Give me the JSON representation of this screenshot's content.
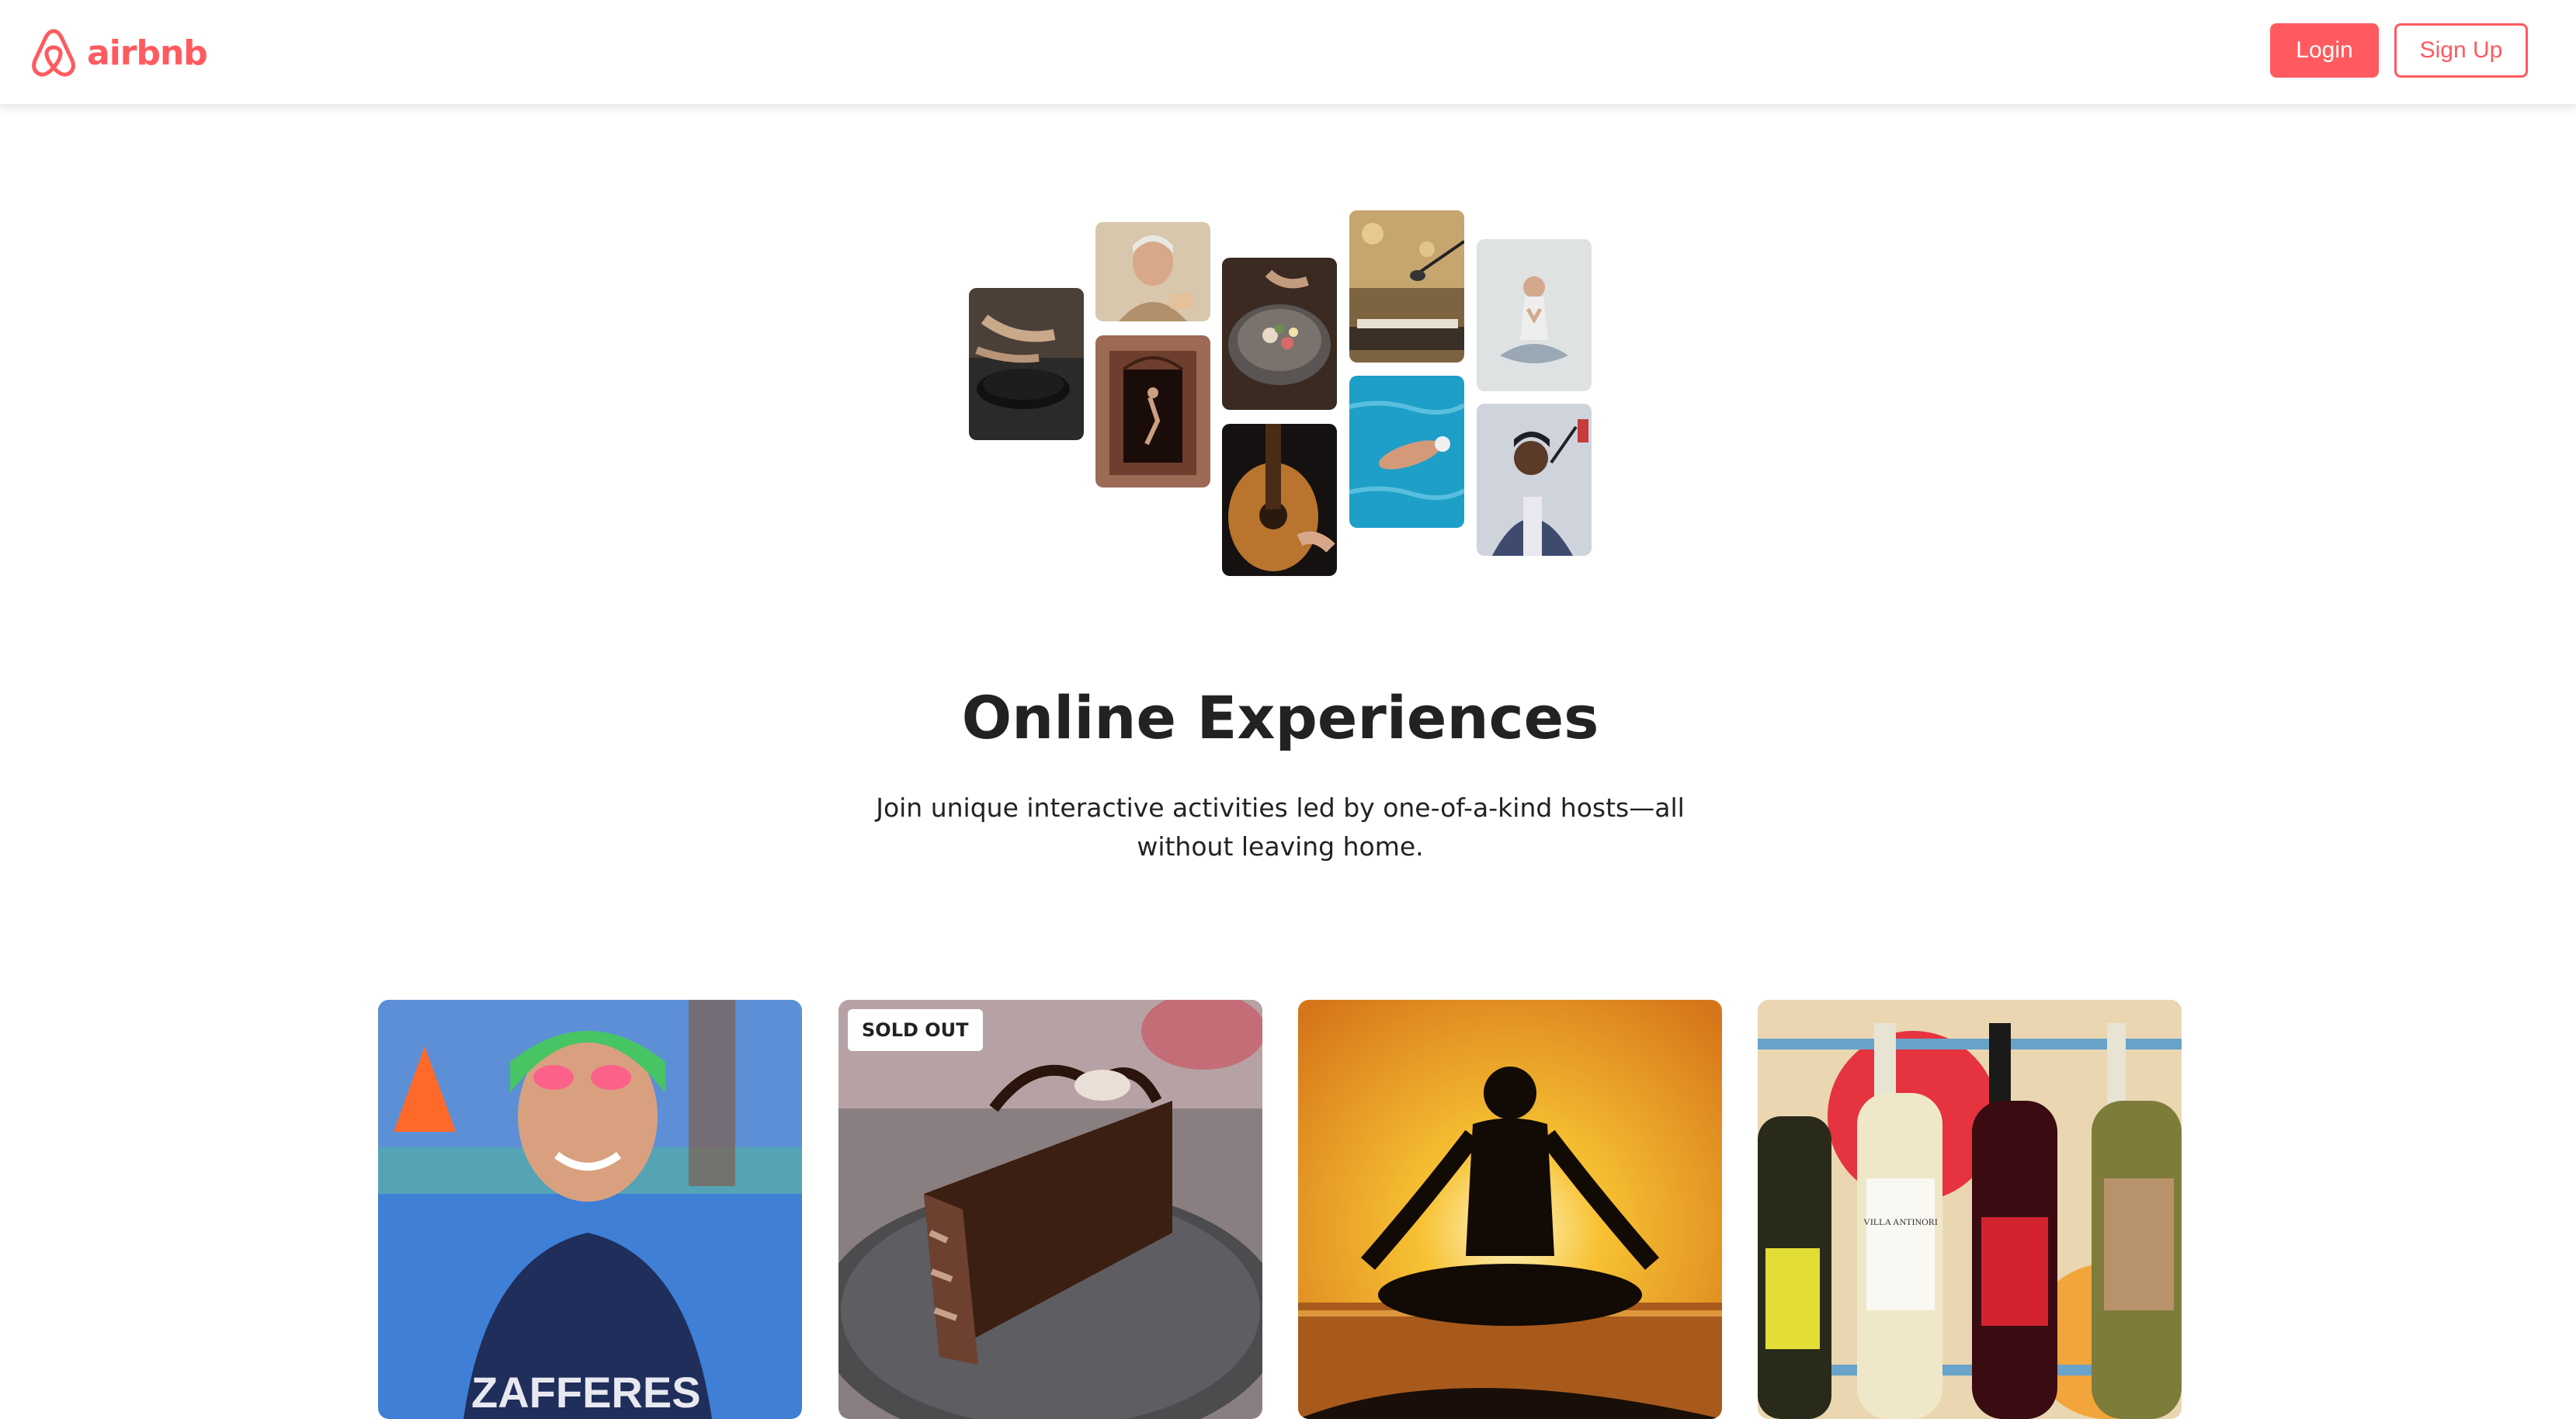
{
  "nav": {
    "logo_text": "airbnb",
    "login_label": "Login",
    "signup_label": "Sign Up"
  },
  "hero": {
    "images": [
      {
        "name": "cooking-pan-photo"
      },
      {
        "name": "chef-woman-photo"
      },
      {
        "name": "doorway-dancer-photo"
      },
      {
        "name": "food-bowl-photo"
      },
      {
        "name": "guitar-photo"
      },
      {
        "name": "microphone-stage-photo"
      },
      {
        "name": "swimmer-photo"
      },
      {
        "name": "yoga-woman-photo"
      },
      {
        "name": "singer-photo"
      }
    ]
  },
  "main": {
    "title": "Online Experiences",
    "subtitle": "Join unique interactive activities led by one-of-a-kind hosts—all without leaving home."
  },
  "cards": [
    {
      "image": "swimmer-athlete-photo",
      "badge": "",
      "shirt_text": "ZAFFERES"
    },
    {
      "image": "chocolate-cake-photo",
      "badge": "SOLD OUT"
    },
    {
      "image": "yoga-sunset-silhouette-photo",
      "badge": ""
    },
    {
      "image": "wine-bottles-photo",
      "badge": "",
      "label_text": "VILLA ANTINORI"
    }
  ],
  "colors": {
    "brand": "#FF5A5F",
    "text": "#222222"
  }
}
